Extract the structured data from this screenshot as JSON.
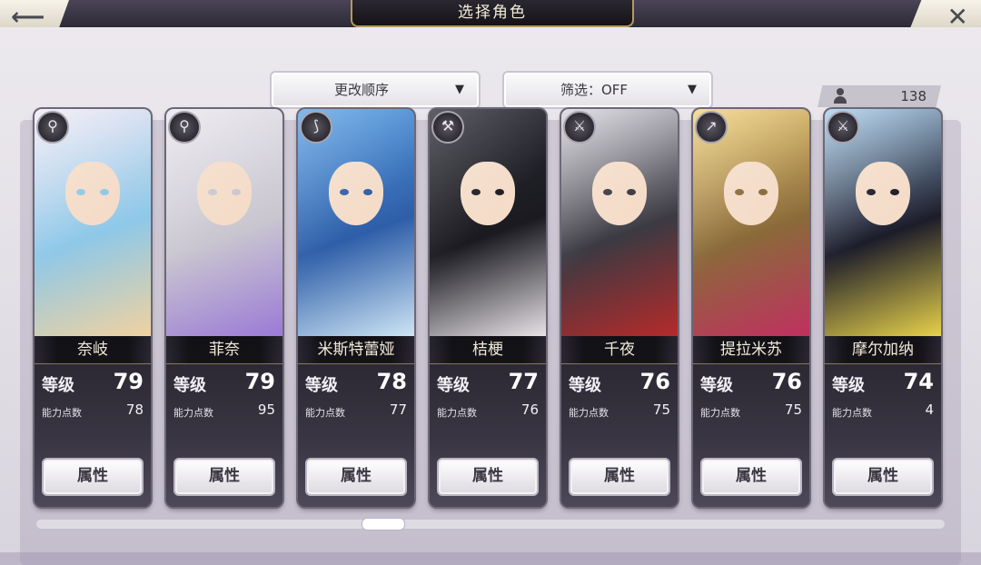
{
  "header": {
    "title": "选择角色",
    "back_icon": "back-arrow-icon",
    "close_icon": "close-icon"
  },
  "controls": {
    "sort_label": "更改顺序",
    "filter_label": "筛选：OFF",
    "count": "138"
  },
  "labels": {
    "level": "等级",
    "ability_points": "能力点数",
    "attribute_button": "属性"
  },
  "characters": [
    {
      "name": "奈岐",
      "level": "79",
      "ability_points": "78",
      "weapon": "staff-icon",
      "palette": [
        "#f2e9f4",
        "#8ec8e8",
        "#f0d2a0"
      ]
    },
    {
      "name": "菲奈",
      "level": "79",
      "ability_points": "95",
      "weapon": "staff-icon",
      "palette": [
        "#e8e6ec",
        "#c9c6d0",
        "#9b7ad6"
      ]
    },
    {
      "name": "米斯特蕾娅",
      "level": "78",
      "ability_points": "77",
      "weapon": "bow-icon",
      "palette": [
        "#5aa2e6",
        "#2e5ea8",
        "#cde4f4"
      ]
    },
    {
      "name": "桔梗",
      "level": "77",
      "ability_points": "76",
      "weapon": "axe-icon",
      "palette": [
        "#2a2a33",
        "#1a1a20",
        "#e7e2e6"
      ]
    },
    {
      "name": "千夜",
      "level": "76",
      "ability_points": "75",
      "weapon": "sword-icon",
      "palette": [
        "#d8d6de",
        "#3b3a42",
        "#b52a2a"
      ]
    },
    {
      "name": "提拉米苏",
      "level": "76",
      "ability_points": "75",
      "weapon": "spear-icon",
      "palette": [
        "#f2d27a",
        "#8a6a3a",
        "#c03060"
      ]
    },
    {
      "name": "摩尔加纳",
      "level": "74",
      "ability_points": "4",
      "weapon": "sword-icon",
      "palette": [
        "#a8cfee",
        "#1c1c2a",
        "#e6d14a"
      ]
    }
  ]
}
